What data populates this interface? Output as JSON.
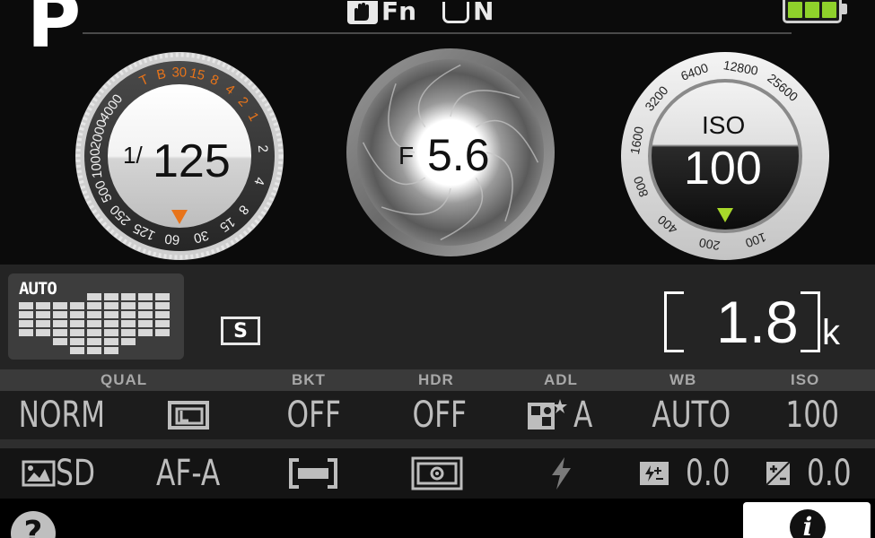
{
  "top_bar": {
    "shooting_mode": "P",
    "fn_label": "Fn",
    "n_label": "N",
    "battery_level": 1.0
  },
  "shutter_dial": {
    "value_prefix": "1/",
    "value": "125",
    "scale_orange": [
      "1",
      "2",
      "4",
      "8",
      "15",
      "30",
      "B",
      "T"
    ],
    "scale_white": [
      "4000",
      "2000",
      "1000",
      "500",
      "250",
      "125",
      "60",
      "30",
      "15",
      "8",
      "4",
      "2"
    ]
  },
  "aperture_dial": {
    "prefix": "F",
    "value": "5.6"
  },
  "iso_dial": {
    "label": "ISO",
    "value": "100",
    "scale": [
      "25600",
      "12800",
      "6400",
      "3200",
      "1600",
      "800",
      "400",
      "200",
      "100"
    ]
  },
  "af_area": {
    "label": "AUTO"
  },
  "image_area_badge": "S",
  "remaining_shots": {
    "value": "1.8",
    "unit": "k"
  },
  "settings_header": {
    "qual": "QUAL",
    "bkt": "BKT",
    "hdr": "HDR",
    "adl": "ADL",
    "wb": "WB",
    "iso": "ISO"
  },
  "settings_row1": {
    "quality": "NORM",
    "bkt": "OFF",
    "hdr": "OFF",
    "adl": "A",
    "wb": "AUTO",
    "iso": "100"
  },
  "settings_row2": {
    "picture_control": "SD",
    "focus_mode": "AF-A",
    "flash_comp": "0.0",
    "exposure_comp": "0.0"
  },
  "bottom_bar": {
    "help": "?",
    "info": "i"
  },
  "colors": {
    "accent_orange": "#e8741a",
    "iso_indicator": "#a8d82a",
    "battery": "#8fd12b"
  }
}
